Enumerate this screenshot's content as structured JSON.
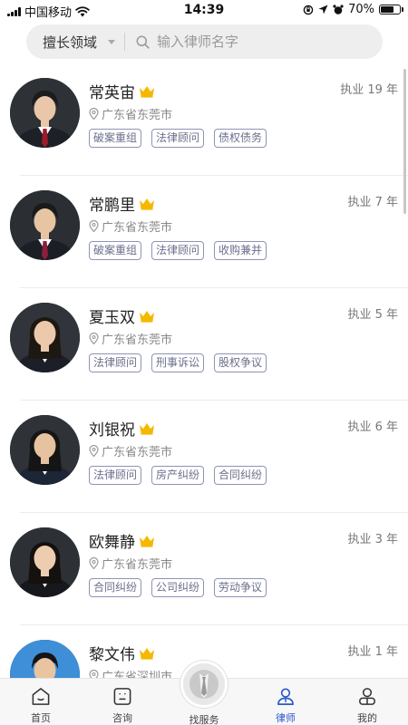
{
  "status_bar": {
    "carrier": "中国移动",
    "time": "14:39",
    "battery": "70%",
    "battery_level": 0.7
  },
  "search": {
    "field_label": "擅长领域",
    "placeholder": "输入律师名字"
  },
  "lawyers": [
    {
      "name": "常英宙",
      "location": "广东省东莞市",
      "years": "执业 19 年",
      "tags": [
        "破案重组",
        "法律顾问",
        "债权债务"
      ]
    },
    {
      "name": "常鹏里",
      "location": "广东省东莞市",
      "years": "执业 7 年",
      "tags": [
        "破案重组",
        "法律顾问",
        "收购兼并"
      ]
    },
    {
      "name": "夏玉双",
      "location": "广东省东莞市",
      "years": "执业 5 年",
      "tags": [
        "法律顾问",
        "刑事诉讼",
        "股权争议"
      ]
    },
    {
      "name": "刘银祝",
      "location": "广东省东莞市",
      "years": "执业 6 年",
      "tags": [
        "法律顾问",
        "房产纠纷",
        "合同纠纷"
      ]
    },
    {
      "name": "欧舞静",
      "location": "广东省东莞市",
      "years": "执业 3 年",
      "tags": [
        "合同纠纷",
        "公司纠纷",
        "劳动争议"
      ]
    },
    {
      "name": "黎文伟",
      "location": "广东省深圳市",
      "years": "执业 1 年",
      "tags": []
    }
  ],
  "tabs": {
    "home": "首页",
    "consult": "咨询",
    "find_service": "找服务",
    "lawyer": "律师",
    "mine": "我的"
  },
  "colors": {
    "accent": "#2a59c9",
    "tag_border": "#8f93b4",
    "crown": "#f5b800"
  }
}
